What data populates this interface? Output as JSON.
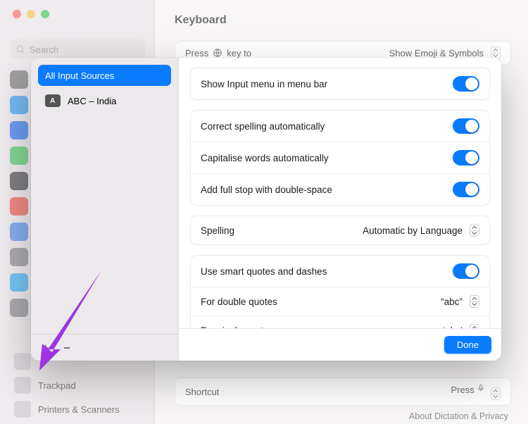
{
  "window": {
    "title": "Keyboard",
    "search_placeholder": "Search",
    "sidebar_tiles_colors": [
      "#6c6c70",
      "#1797ff",
      "#1565ff",
      "#30c552",
      "#3a3a3c",
      "#ff453a",
      "#3c82f6",
      "#7d7d82",
      "#1ba7ff",
      "#7d7d82"
    ],
    "sidebar_bottom_items": [
      {
        "label": ""
      },
      {
        "label": "Trackpad"
      },
      {
        "label": "Printers & Scanners"
      }
    ],
    "press_row": {
      "label": "Press 🌐 key to",
      "value": "Show Emoji & Symbols"
    },
    "shortcut_row": {
      "label": "Shortcut",
      "value": "Press 🎙"
    },
    "about_link": "About Dictation & Privacy"
  },
  "modal": {
    "sidebar": {
      "items": [
        {
          "label": "All Input Sources",
          "selected": true
        },
        {
          "label": "ABC – India",
          "selected": false,
          "badge": "A"
        }
      ],
      "add_tooltip": "+",
      "remove_tooltip": "−"
    },
    "groups": [
      {
        "rows": [
          {
            "label": "Show Input menu in menu bar",
            "control": "toggle",
            "on": true
          }
        ]
      },
      {
        "rows": [
          {
            "label": "Correct spelling automatically",
            "control": "toggle",
            "on": true
          },
          {
            "label": "Capitalise words automatically",
            "control": "toggle",
            "on": true
          },
          {
            "label": "Add full stop with double-space",
            "control": "toggle",
            "on": true
          }
        ]
      },
      {
        "rows": [
          {
            "label": "Spelling",
            "control": "select",
            "value": "Automatic by Language"
          }
        ]
      },
      {
        "rows": [
          {
            "label": "Use smart quotes and dashes",
            "control": "toggle",
            "on": true
          },
          {
            "label": "For double quotes",
            "control": "select",
            "value": "“abc”"
          },
          {
            "label": "For single quotes",
            "control": "select",
            "value": "‘abc’"
          }
        ]
      }
    ],
    "done_label": "Done"
  },
  "annotation": {
    "arrow_color": "#9b2fe0"
  }
}
